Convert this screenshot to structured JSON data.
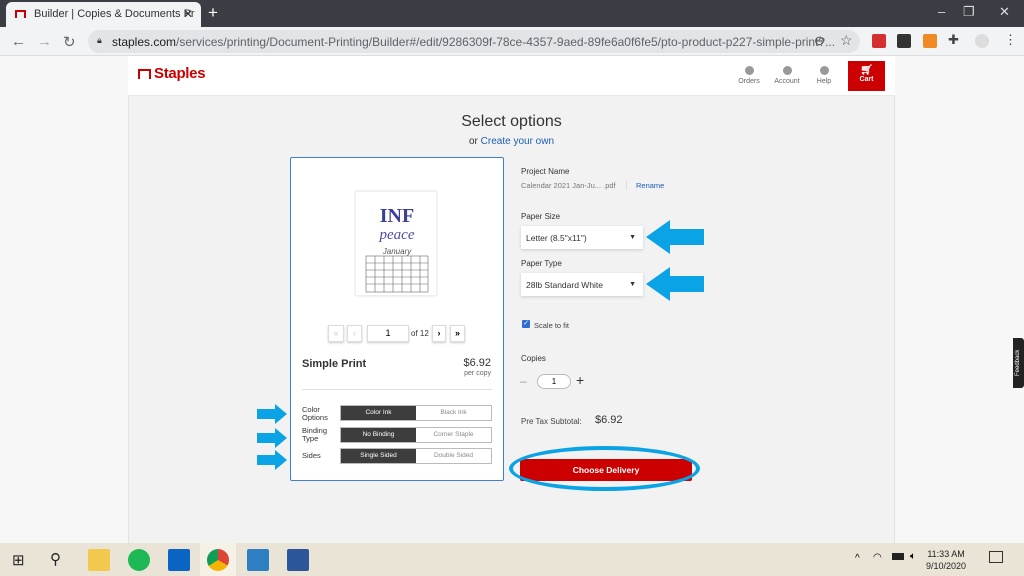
{
  "browser": {
    "tab_title": "Builder | Copies & Documents Pr",
    "url_host": "staples.com",
    "url_path": "/services/printing/Document-Printing/Builder#/edit/9286309f-78ce-4357-9aed-89fe6a0f6fe5/pto-product-p227-simple-print?..."
  },
  "header": {
    "logo": "Staples",
    "orders": "Orders",
    "account": "Account",
    "help": "Help",
    "cart": "Cart"
  },
  "main": {
    "title": "Select options",
    "or": "or",
    "create_link": "Create your own"
  },
  "preview": {
    "page": "1",
    "of": "of 12"
  },
  "product": {
    "name": "Simple Print",
    "price": "$6.92",
    "per": "per copy",
    "options": [
      {
        "label": "Color Options",
        "choices": [
          "Color Ink",
          "Black Ink"
        ],
        "selected": 0
      },
      {
        "label": "Binding Type",
        "choices": [
          "No Binding",
          "Corner Staple"
        ],
        "selected": 0
      },
      {
        "label": "Sides",
        "choices": [
          "Single Sided",
          "Double Sided"
        ],
        "selected": 0
      }
    ]
  },
  "form": {
    "project_label": "Project Name",
    "project_name": "Calendar 2021 Jan-Ju... .pdf",
    "rename": "Rename",
    "paper_size_label": "Paper Size",
    "paper_size": "Letter (8.5\"x11\")",
    "paper_type_label": "Paper Type",
    "paper_type": "28lb Standard White",
    "scale_label": "Scale to fit",
    "scale_checked": true,
    "copies_label": "Copies",
    "copies": "1",
    "subtotal_label": "Pre Tax Subtotal:",
    "subtotal": "$6.92",
    "deliver_button": "Choose Delivery"
  },
  "feedback": "Feedback",
  "taskbar": {
    "time": "11:33 AM",
    "date": "9/10/2020"
  },
  "colors": {
    "brand": "#cc0000",
    "annotation": "#0aa3e6",
    "selected_option": "#3d3d3d"
  }
}
